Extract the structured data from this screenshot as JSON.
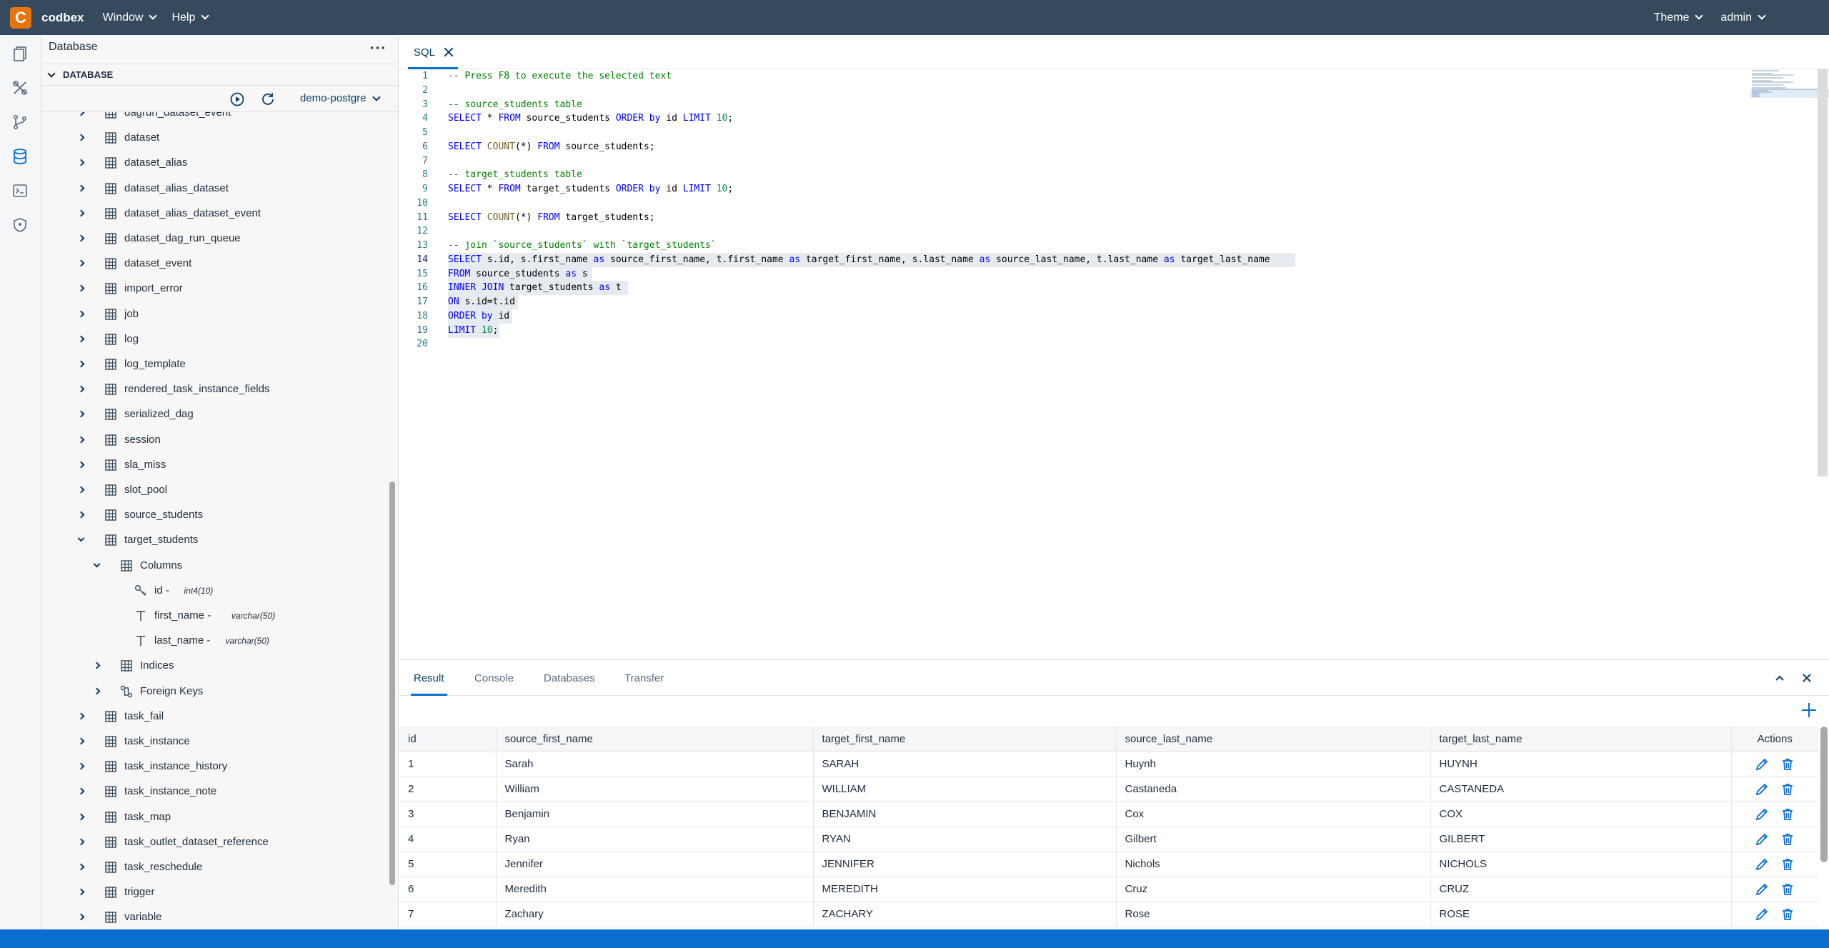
{
  "app": {
    "brand": "codbex",
    "menu": [
      "Window",
      "Help"
    ],
    "right_menu": [
      "Theme",
      "admin"
    ]
  },
  "activity": [
    "documents-icon",
    "tools-icon",
    "git-branch-icon",
    "database-icon",
    "terminal-icon",
    "shield-icon"
  ],
  "explorer": {
    "title": "Database",
    "section": "DATABASE",
    "database": "demo-postgre",
    "items": [
      {
        "label": "dagrun_dataset_event",
        "level": 1,
        "expanded": false,
        "type": "table"
      },
      {
        "label": "dataset",
        "level": 1,
        "expanded": false,
        "type": "table"
      },
      {
        "label": "dataset_alias",
        "level": 1,
        "expanded": false,
        "type": "table"
      },
      {
        "label": "dataset_alias_dataset",
        "level": 1,
        "expanded": false,
        "type": "table"
      },
      {
        "label": "dataset_alias_dataset_event",
        "level": 1,
        "expanded": false,
        "type": "table"
      },
      {
        "label": "dataset_dag_run_queue",
        "level": 1,
        "expanded": false,
        "type": "table"
      },
      {
        "label": "dataset_event",
        "level": 1,
        "expanded": false,
        "type": "table"
      },
      {
        "label": "import_error",
        "level": 1,
        "expanded": false,
        "type": "table"
      },
      {
        "label": "job",
        "level": 1,
        "expanded": false,
        "type": "table"
      },
      {
        "label": "log",
        "level": 1,
        "expanded": false,
        "type": "table"
      },
      {
        "label": "log_template",
        "level": 1,
        "expanded": false,
        "type": "table"
      },
      {
        "label": "rendered_task_instance_fields",
        "level": 1,
        "expanded": false,
        "type": "table"
      },
      {
        "label": "serialized_dag",
        "level": 1,
        "expanded": false,
        "type": "table"
      },
      {
        "label": "session",
        "level": 1,
        "expanded": false,
        "type": "table"
      },
      {
        "label": "sla_miss",
        "level": 1,
        "expanded": false,
        "type": "table"
      },
      {
        "label": "slot_pool",
        "level": 1,
        "expanded": false,
        "type": "table"
      },
      {
        "label": "source_students",
        "level": 1,
        "expanded": false,
        "type": "table"
      },
      {
        "label": "target_students",
        "level": 1,
        "expanded": true,
        "type": "table"
      },
      {
        "label": "Columns",
        "level": 2,
        "expanded": true,
        "type": "folder"
      },
      {
        "label": "id - ",
        "dtype": "int4(10)",
        "level": 3,
        "type": "key"
      },
      {
        "label": "first_name - ",
        "dtype": "varchar(50)",
        "level": 3,
        "type": "text"
      },
      {
        "label": "last_name - ",
        "dtype": "varchar(50)",
        "level": 3,
        "type": "text"
      },
      {
        "label": "Indices",
        "level": 2,
        "expanded": false,
        "type": "folder"
      },
      {
        "label": "Foreign Keys",
        "level": 2,
        "expanded": false,
        "type": "fk"
      },
      {
        "label": "task_fail",
        "level": 1,
        "expanded": false,
        "type": "table"
      },
      {
        "label": "task_instance",
        "level": 1,
        "expanded": false,
        "type": "table"
      },
      {
        "label": "task_instance_history",
        "level": 1,
        "expanded": false,
        "type": "table"
      },
      {
        "label": "task_instance_note",
        "level": 1,
        "expanded": false,
        "type": "table"
      },
      {
        "label": "task_map",
        "level": 1,
        "expanded": false,
        "type": "table"
      },
      {
        "label": "task_outlet_dataset_reference",
        "level": 1,
        "expanded": false,
        "type": "table"
      },
      {
        "label": "task_reschedule",
        "level": 1,
        "expanded": false,
        "type": "table"
      },
      {
        "label": "trigger",
        "level": 1,
        "expanded": false,
        "type": "table"
      },
      {
        "label": "variable",
        "level": 1,
        "expanded": false,
        "type": "table"
      }
    ]
  },
  "editor": {
    "tab": "SQL",
    "current_line": 14,
    "lines": [
      [
        [
          "cm",
          "-- Press F8 to execute the selected text"
        ]
      ],
      [],
      [
        [
          "cm",
          "-- source_students table"
        ]
      ],
      [
        [
          "kw",
          "SELECT"
        ],
        [
          "op",
          " * "
        ],
        [
          "kw",
          "FROM"
        ],
        [
          "op",
          " source_students "
        ],
        [
          "kw",
          "ORDER by"
        ],
        [
          "op",
          " id "
        ],
        [
          "kw",
          "LIMIT"
        ],
        [
          "num",
          " 10"
        ],
        [
          "op",
          ";"
        ]
      ],
      [],
      [
        [
          "kw",
          "SELECT"
        ],
        [
          "fn",
          " COUNT"
        ],
        [
          "op",
          "(*) "
        ],
        [
          "kw",
          "FROM"
        ],
        [
          "op",
          " source_students;"
        ]
      ],
      [],
      [
        [
          "cm",
          "-- target_students table"
        ]
      ],
      [
        [
          "kw",
          "SELECT"
        ],
        [
          "op",
          " * "
        ],
        [
          "kw",
          "FROM"
        ],
        [
          "op",
          " target_students "
        ],
        [
          "kw",
          "ORDER by"
        ],
        [
          "op",
          " id "
        ],
        [
          "kw",
          "LIMIT"
        ],
        [
          "num",
          " 10"
        ],
        [
          "op",
          ";"
        ]
      ],
      [],
      [
        [
          "kw",
          "SELECT"
        ],
        [
          "fn",
          " COUNT"
        ],
        [
          "op",
          "(*) "
        ],
        [
          "kw",
          "FROM"
        ],
        [
          "op",
          " target_students;"
        ]
      ],
      [],
      [
        [
          "cm",
          "-- join `source_students` with `target_students`"
        ]
      ],
      [
        [
          "kw",
          "SELECT"
        ],
        [
          "op",
          " s.id, s.first_name "
        ],
        [
          "kw",
          "as"
        ],
        [
          "op",
          " source_first_name, t.first_name "
        ],
        [
          "kw",
          "as"
        ],
        [
          "op",
          " target_first_name, s.last_name "
        ],
        [
          "kw",
          "as"
        ],
        [
          "op",
          " source_last_name, t.last_name "
        ],
        [
          "kw",
          "as"
        ],
        [
          "op",
          " target_last_name"
        ]
      ],
      [
        [
          "kw",
          "FROM"
        ],
        [
          "op",
          " source_students "
        ],
        [
          "kw",
          "as"
        ],
        [
          "op",
          " s"
        ]
      ],
      [
        [
          "kw",
          "INNER JOIN"
        ],
        [
          "op",
          " target_students "
        ],
        [
          "kw",
          "as"
        ],
        [
          "op",
          " t"
        ]
      ],
      [
        [
          "kw",
          "ON"
        ],
        [
          "op",
          " s.id=t.id"
        ]
      ],
      [
        [
          "kw",
          "ORDER by"
        ],
        [
          "op",
          " id"
        ]
      ],
      [
        [
          "kw",
          "LIMIT"
        ],
        [
          "num",
          " 10"
        ],
        [
          "op",
          ";"
        ]
      ],
      []
    ],
    "highlight": [
      14,
      15,
      16,
      17,
      18,
      19
    ]
  },
  "panel": {
    "tabs": [
      "Result",
      "Console",
      "Databases",
      "Transfer"
    ],
    "active_tab": "Result",
    "columns": [
      "id",
      "source_first_name",
      "target_first_name",
      "source_last_name",
      "target_last_name",
      "Actions"
    ],
    "rows": [
      [
        "1",
        "Sarah",
        "SARAH",
        "Huynh",
        "HUYNH"
      ],
      [
        "2",
        "William",
        "WILLIAM",
        "Castaneda",
        "CASTANEDA"
      ],
      [
        "3",
        "Benjamin",
        "BENJAMIN",
        "Cox",
        "COX"
      ],
      [
        "4",
        "Ryan",
        "RYAN",
        "Gilbert",
        "GILBERT"
      ],
      [
        "5",
        "Jennifer",
        "JENNIFER",
        "Nichols",
        "NICHOLS"
      ],
      [
        "6",
        "Meredith",
        "MEREDITH",
        "Cruz",
        "CRUZ"
      ],
      [
        "7",
        "Zachary",
        "ZACHARY",
        "Rose",
        "ROSE"
      ]
    ]
  },
  "colors": {
    "shell": "#354a5f",
    "accent": "#0a6ed1",
    "logo": "#e9730c"
  }
}
